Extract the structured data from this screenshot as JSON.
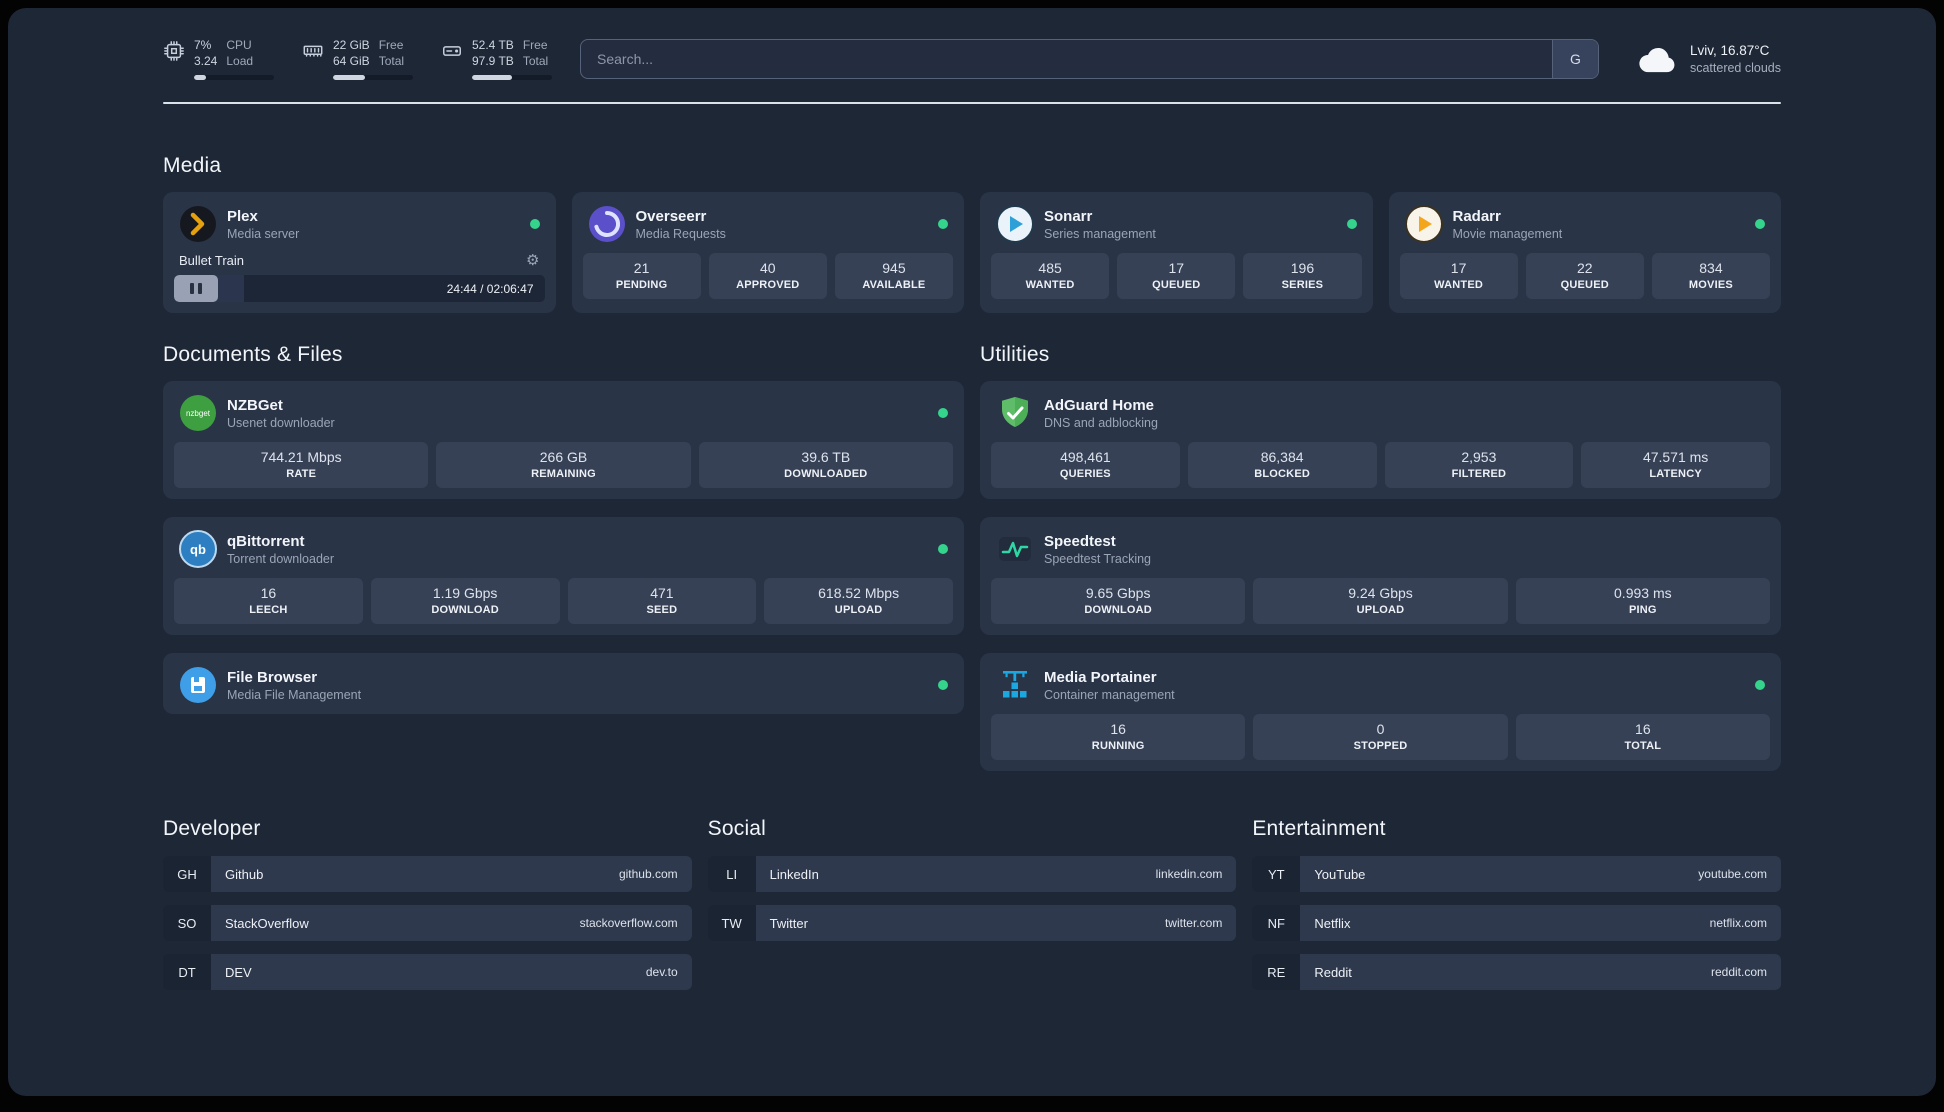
{
  "colors": {
    "background": "#1e2736",
    "card": "#2a3447",
    "stat_tile": "#364156",
    "status_online": "#35d48c",
    "plex_accent": "#e5a00d",
    "radarr_accent": "#f3a61c",
    "sonarr_accent": "#2f9fd8",
    "speedtest_accent": "#2fd7a4",
    "nzbget_green": "#3d9f3f",
    "adguard_green": "#5fbd6a",
    "portainer_blue": "#1ba7e0"
  },
  "topbar": {
    "resources": [
      {
        "name": "cpu",
        "value_top": "7%",
        "value_bottom": "3.24",
        "label_top": "CPU",
        "label_bottom": "Load",
        "progress": 15
      },
      {
        "name": "memory",
        "value_top": "22 GiB",
        "value_bottom": "64 GiB",
        "label_top": "Free",
        "label_bottom": "Total",
        "progress": 40
      },
      {
        "name": "disk",
        "value_top": "52.4 TB",
        "value_bottom": "97.9 TB",
        "label_top": "Free",
        "label_bottom": "Total",
        "progress": 50
      }
    ],
    "search": {
      "placeholder": "Search...",
      "engine_button": "G"
    },
    "weather": {
      "location": "Lviv, 16.87°C",
      "condition": "scattered clouds"
    }
  },
  "media": {
    "heading": "Media",
    "plex": {
      "name": "Plex",
      "subtitle": "Media server",
      "now_playing": "Bullet Train",
      "time": "24:44 / 02:06:47",
      "progress": 19
    },
    "overseerr": {
      "name": "Overseerr",
      "subtitle": "Media Requests",
      "stats": [
        {
          "value": "21",
          "label": "PENDING"
        },
        {
          "value": "40",
          "label": "APPROVED"
        },
        {
          "value": "945",
          "label": "AVAILABLE"
        }
      ]
    },
    "sonarr": {
      "name": "Sonarr",
      "subtitle": "Series management",
      "stats": [
        {
          "value": "485",
          "label": "WANTED"
        },
        {
          "value": "17",
          "label": "QUEUED"
        },
        {
          "value": "196",
          "label": "SERIES"
        }
      ]
    },
    "radarr": {
      "name": "Radarr",
      "subtitle": "Movie management",
      "stats": [
        {
          "value": "17",
          "label": "WANTED"
        },
        {
          "value": "22",
          "label": "QUEUED"
        },
        {
          "value": "834",
          "label": "MOVIES"
        }
      ]
    }
  },
  "documents": {
    "heading": "Documents & Files",
    "nzbget": {
      "name": "NZBGet",
      "subtitle": "Usenet downloader",
      "stats": [
        {
          "value": "744.21 Mbps",
          "label": "RATE"
        },
        {
          "value": "266 GB",
          "label": "REMAINING"
        },
        {
          "value": "39.6 TB",
          "label": "DOWNLOADED"
        }
      ]
    },
    "qbittorrent": {
      "name": "qBittorrent",
      "subtitle": "Torrent downloader",
      "stats": [
        {
          "value": "16",
          "label": "LEECH"
        },
        {
          "value": "1.19 Gbps",
          "label": "DOWNLOAD"
        },
        {
          "value": "471",
          "label": "SEED"
        },
        {
          "value": "618.52 Mbps",
          "label": "UPLOAD"
        }
      ]
    },
    "filebrowser": {
      "name": "File Browser",
      "subtitle": "Media File Management"
    }
  },
  "utilities": {
    "heading": "Utilities",
    "adguard": {
      "name": "AdGuard Home",
      "subtitle": "DNS and adblocking",
      "stats": [
        {
          "value": "498,461",
          "label": "QUERIES"
        },
        {
          "value": "86,384",
          "label": "BLOCKED"
        },
        {
          "value": "2,953",
          "label": "FILTERED"
        },
        {
          "value": "47.571 ms",
          "label": "LATENCY"
        }
      ]
    },
    "speedtest": {
      "name": "Speedtest",
      "subtitle": "Speedtest Tracking",
      "stats": [
        {
          "value": "9.65 Gbps",
          "label": "DOWNLOAD"
        },
        {
          "value": "9.24 Gbps",
          "label": "UPLOAD"
        },
        {
          "value": "0.993 ms",
          "label": "PING"
        }
      ]
    },
    "portainer": {
      "name": "Media Portainer",
      "subtitle": "Container management",
      "stats": [
        {
          "value": "16",
          "label": "RUNNING"
        },
        {
          "value": "0",
          "label": "STOPPED"
        },
        {
          "value": "16",
          "label": "TOTAL"
        }
      ]
    }
  },
  "bookmarks": [
    {
      "heading": "Developer",
      "items": [
        {
          "abbr": "GH",
          "name": "Github",
          "url": "github.com"
        },
        {
          "abbr": "SO",
          "name": "StackOverflow",
          "url": "stackoverflow.com"
        },
        {
          "abbr": "DT",
          "name": "DEV",
          "url": "dev.to"
        }
      ]
    },
    {
      "heading": "Social",
      "items": [
        {
          "abbr": "LI",
          "name": "LinkedIn",
          "url": "linkedin.com"
        },
        {
          "abbr": "TW",
          "name": "Twitter",
          "url": "twitter.com"
        }
      ]
    },
    {
      "heading": "Entertainment",
      "items": [
        {
          "abbr": "YT",
          "name": "YouTube",
          "url": "youtube.com"
        },
        {
          "abbr": "NF",
          "name": "Netflix",
          "url": "netflix.com"
        },
        {
          "abbr": "RE",
          "name": "Reddit",
          "url": "reddit.com"
        }
      ]
    }
  ],
  "icon_text": {
    "nzbget": "nzbget",
    "qbittorrent": "qb"
  }
}
